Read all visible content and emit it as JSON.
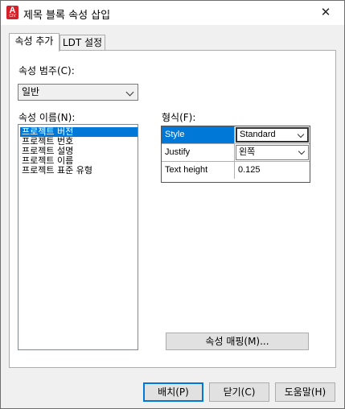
{
  "window": {
    "title": "제목 블록 속성 삽입",
    "icon_letter": "A",
    "icon_sub": "CIV",
    "close_glyph": "✕"
  },
  "tabs": [
    {
      "label": "속성 추가",
      "active": true
    },
    {
      "label": "LDT 설정",
      "active": false
    }
  ],
  "category": {
    "label": "속성 범주(C):",
    "selected": "일반"
  },
  "attribute_names": {
    "label": "속성 이름(N):",
    "items": [
      "프로젝트 버전",
      "프로젝트 번호",
      "프로젝트 설명",
      "프로젝트 이름",
      "프로젝트 표준 유형"
    ],
    "selected_index": 0
  },
  "format": {
    "label": "형식(F):",
    "rows": [
      {
        "name": "Style",
        "value": "Standard",
        "control": "combo"
      },
      {
        "name": "Justify",
        "value": "왼쪽",
        "control": "combo"
      },
      {
        "name": "Text height",
        "value": "0.125",
        "control": "text"
      }
    ]
  },
  "buttons": {
    "mapping": "속성 매핑(M)...",
    "place": "배치(P)",
    "close": "닫기(C)",
    "help": "도움말(H)"
  },
  "colors": {
    "selection": "#0078d7",
    "brand": "#d3212b"
  }
}
